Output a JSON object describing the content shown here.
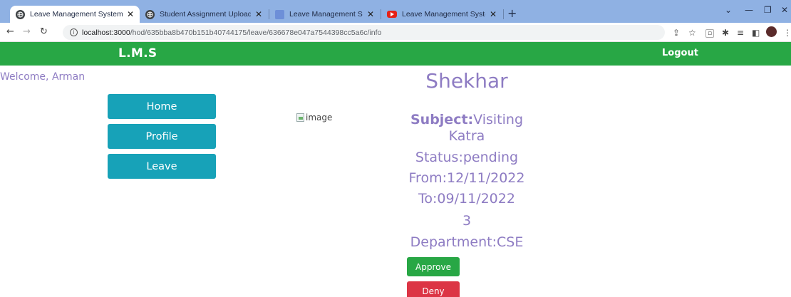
{
  "browser": {
    "tabs": [
      {
        "label": "Leave Management System"
      },
      {
        "label": "Student Assignment Upload"
      },
      {
        "label": "Leave Management System Proje"
      },
      {
        "label": "Leave Management System Proje"
      }
    ],
    "url_host": "localhost:3000",
    "url_path": "/hod/635bba8b470b151b40744175/leave/636678e047a7544398cc5a6c/info",
    "colors": {
      "tabstrip": "#8fb1e3",
      "youtube": "#e62117"
    }
  },
  "app": {
    "brand": "L.M.S",
    "logout": "Logout",
    "welcome": "Welcome, Arman",
    "nav": [
      "Home",
      "Profile",
      "Leave"
    ],
    "image_alt": "image",
    "colors": {
      "navbar": "#28a745",
      "nav_button": "#17a2b8",
      "text_accent": "#8e7cc3"
    }
  },
  "leave": {
    "name": "Shekhar",
    "subject_label": "Subject:",
    "subject_line1": "Visiting",
    "subject_line2": "Katra",
    "status": "Status:pending",
    "from": "From:12/11/2022",
    "to": "To:09/11/2022",
    "days": "3",
    "department": "Department:CSE",
    "approve_label": "Approve",
    "deny_label": "Deny"
  }
}
